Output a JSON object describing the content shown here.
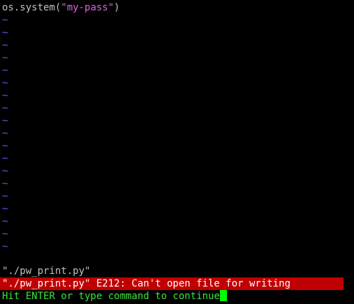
{
  "buffer": {
    "code_prefix": "os.system(",
    "code_string": "\"my-pass\"",
    "code_suffix": ")",
    "tilde": "~",
    "tilde_count": 19
  },
  "messages": {
    "filename_line": "\"./pw_print.py\"",
    "error_line": "\"./pw_print.py\" E212: Can't open file for writing",
    "prompt_line": "Hit ENTER or type command to continue"
  },
  "colors": {
    "background": "#000000",
    "tilde": "#5c5cff",
    "string": "#e060e0",
    "error_bar": "#c00000",
    "prompt": "#40e040",
    "cursor": "#00ff00"
  }
}
